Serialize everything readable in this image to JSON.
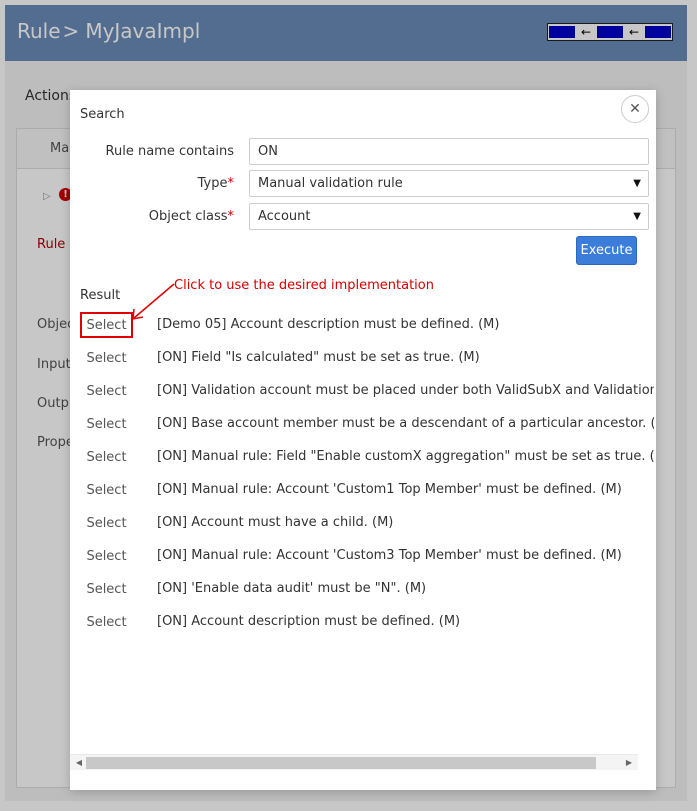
{
  "header": {
    "title_prefix": "Rule",
    "title_sep": ">",
    "title_name": "MyJavaImpl",
    "nav_arrow": "←"
  },
  "background": {
    "actions": "Actions",
    "tab": "Ma",
    "rule_link": "Rule n",
    "labels": [
      "Objec",
      "Input",
      "Outp",
      "Prope"
    ]
  },
  "modal": {
    "title": "Search",
    "close": "✕",
    "fields": {
      "rule_name_label": "Rule name contains",
      "rule_name_value": "ON",
      "type_label": "Type",
      "type_value": "Manual validation rule",
      "object_class_label": "Object class",
      "object_class_value": "Account",
      "required_mark": "*"
    },
    "execute": "Execute",
    "result_label": "Result",
    "annotation": "Click to use the desired implementation",
    "select_label": "Select",
    "results": [
      "[Demo 05] Account description must be defined. (M)",
      "[ON] Field \"Is calculated\" must be set as true. (M)",
      "[ON] Validation account must be placed under both ValidSubX and ValidationX",
      "[ON] Base account member must be a descendant of a particular ancestor. (M)",
      "[ON] Manual rule: Field \"Enable customX aggregation\" must be set as true. (M)",
      "[ON] Manual rule: Account 'Custom1 Top Member' must be defined. (M)",
      "[ON] Account must have a child. (M)",
      "[ON] Manual rule: Account 'Custom3 Top Member' must be defined. (M)",
      "[ON] 'Enable data audit' must be \"N\". (M)",
      "[ON] Account description must be defined. (M)"
    ]
  }
}
